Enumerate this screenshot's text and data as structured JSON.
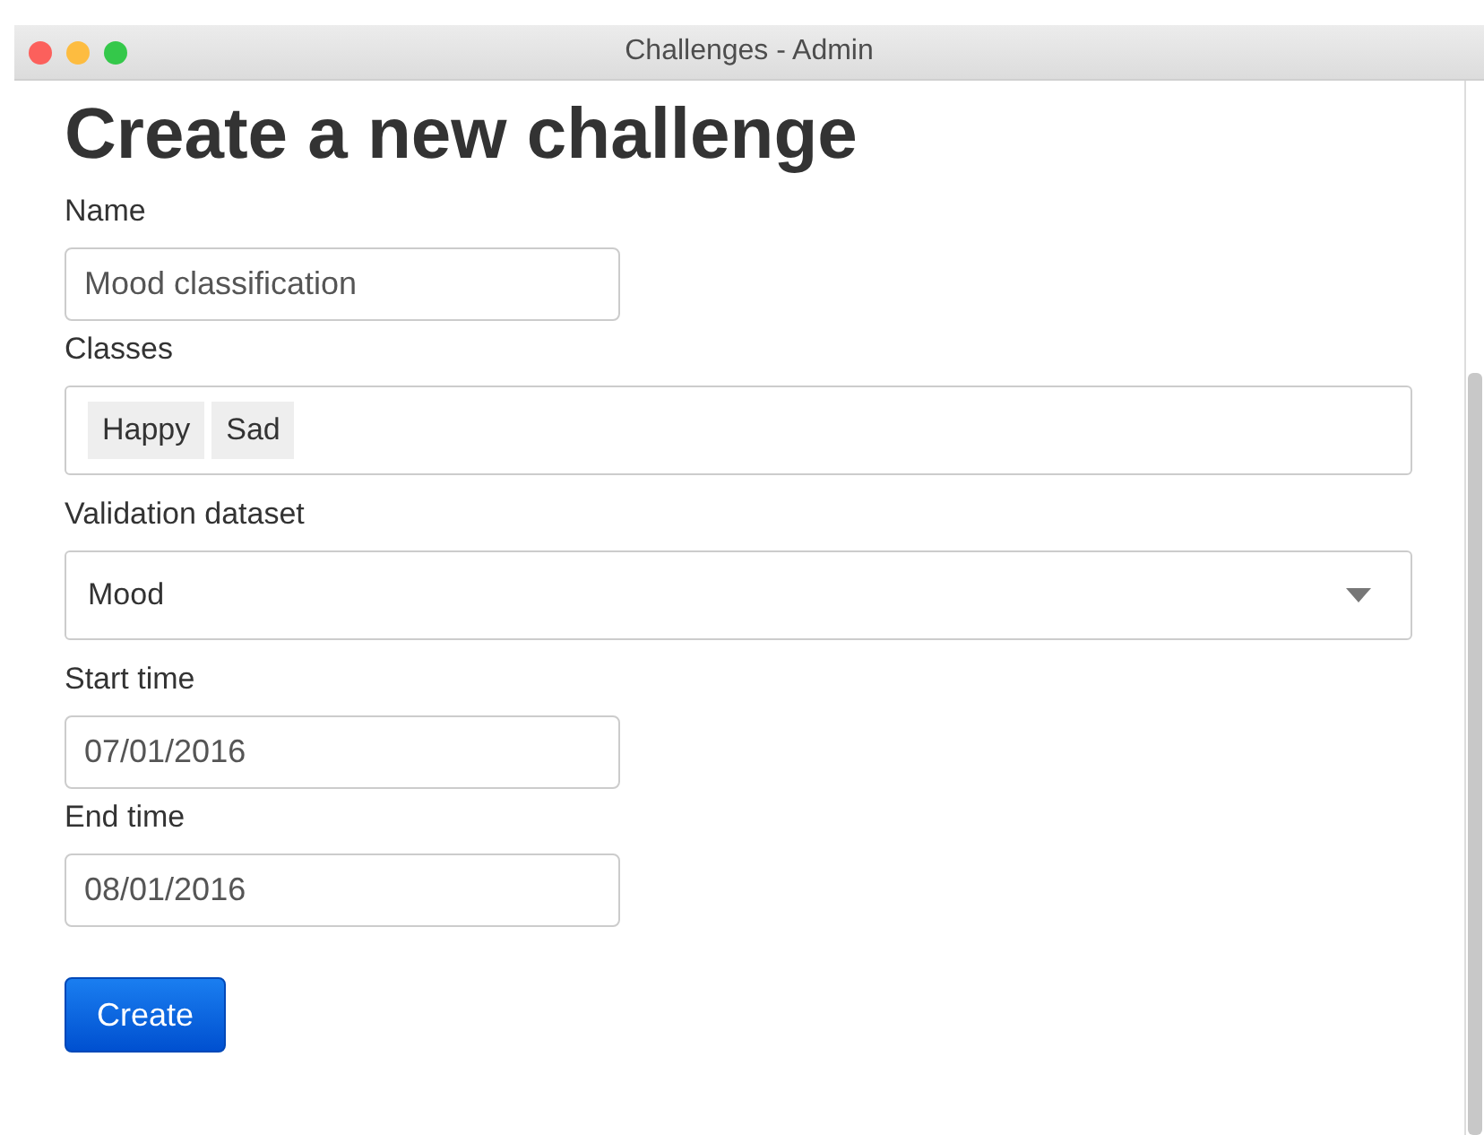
{
  "window": {
    "title": "Challenges - Admin"
  },
  "heading": "Create a new challenge",
  "fields": [
    {
      "kind": "text",
      "label": "Name",
      "value": "Mood classification"
    },
    {
      "kind": "tags",
      "label": "Classes",
      "tags": [
        "Happy",
        "Sad"
      ]
    },
    {
      "kind": "select",
      "label": "Validation dataset",
      "value": "Mood"
    },
    {
      "kind": "text",
      "label": "Start time",
      "value": "07/01/2016"
    },
    {
      "kind": "text",
      "label": "End time",
      "value": "08/01/2016"
    }
  ],
  "submit": "Create"
}
